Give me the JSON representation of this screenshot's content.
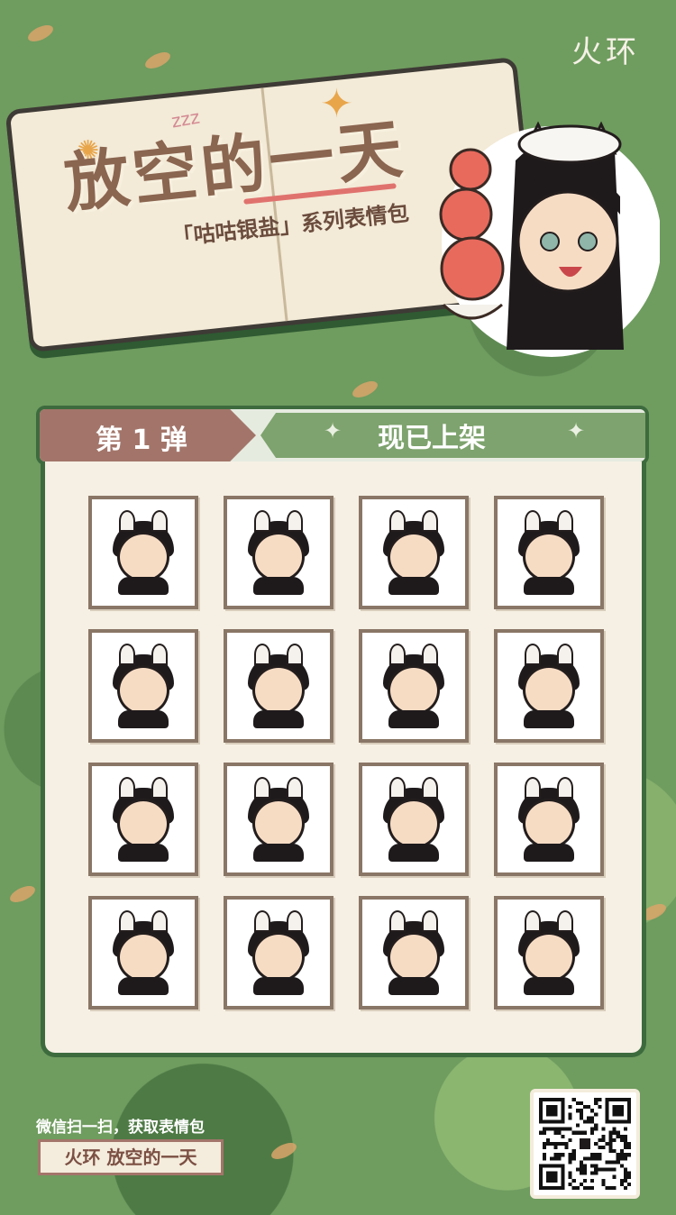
{
  "brand": {
    "logo_text": "火环"
  },
  "header": {
    "title": "放空的一天",
    "subtitle": "「咕咕银盐」系列表情包",
    "zzz": "zzz"
  },
  "banner": {
    "left_label": "第 1 弹",
    "right_label": "现已上架"
  },
  "stickers": [
    {
      "name": "sticker-1"
    },
    {
      "name": "sticker-2"
    },
    {
      "name": "sticker-3"
    },
    {
      "name": "sticker-4"
    },
    {
      "name": "sticker-5"
    },
    {
      "name": "sticker-6"
    },
    {
      "name": "sticker-7"
    },
    {
      "name": "sticker-8"
    },
    {
      "name": "sticker-9"
    },
    {
      "name": "sticker-10"
    },
    {
      "name": "sticker-11"
    },
    {
      "name": "sticker-12"
    },
    {
      "name": "sticker-13"
    },
    {
      "name": "sticker-14"
    },
    {
      "name": "sticker-15"
    },
    {
      "name": "sticker-16"
    }
  ],
  "footer": {
    "scan_text": "微信扫一扫，获取表情包",
    "tag_text": "火环 放空的一天"
  },
  "colors": {
    "background": "#6f9c5f",
    "banner_left": "#a3756a",
    "banner_right": "#7ea36e",
    "frame": "#3d6b3e",
    "panel": "#f6f0e4"
  }
}
